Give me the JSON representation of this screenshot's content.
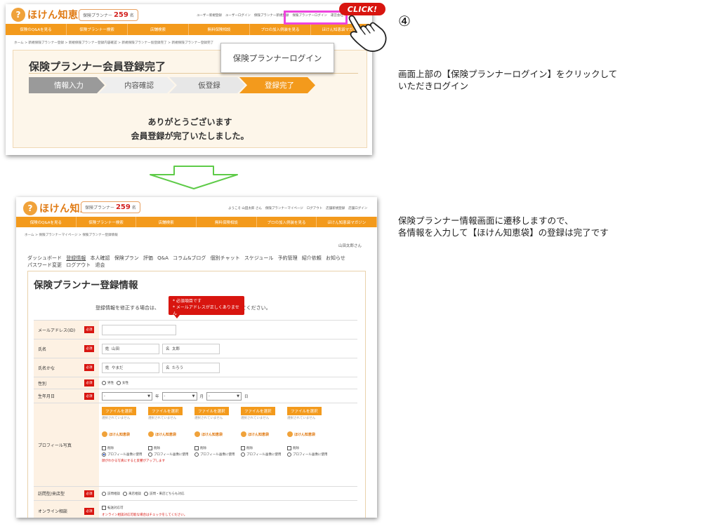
{
  "step_number": "④",
  "step1": {
    "description_lines": [
      "画面上部の【保険プランナーログイン】をクリックして",
      "いただきログイン"
    ],
    "site": {
      "logo_text": "ほけん知恵袋",
      "count_label": "保険プランナー",
      "count_value": "259",
      "count_unit": "名",
      "top_links": [
        "ユーザー新規登録",
        "ユーザーログイン",
        "保険プランナー新規登録",
        "保険プランナーログイン",
        "運営会社"
      ],
      "nav": [
        "保険のQ&Aを見る",
        "保険プランナー検索",
        "店舗検索",
        "無料保険相談",
        "プロの加入例装を見る",
        "ほけん知恵袋マガジン"
      ],
      "breadcrumb": "ホーム > 新規保険プランナー登録 > 新規保険プランナー登録内容確認 > 新規保険プランナー仮登録完了 > 新規保険プランナー登録完了"
    },
    "page_title": "保険プランナー会員登録完了",
    "steps": [
      "情報入力",
      "内容確認",
      "仮登録",
      "登録完了"
    ],
    "thanks_lines": [
      "ありがとうございます",
      "会員登録が完了いたしました。"
    ],
    "popup_label": "保険プランナーログイン",
    "click_label": "CLICK!"
  },
  "step2": {
    "description_lines": [
      "保険プランナー情報画面に遷移しますので、",
      "各情報を入力して【ほけん知恵袋】の登録は完了です"
    ],
    "site": {
      "logo_text": "ほけん知恵袋",
      "count_label": "保険プランナー",
      "count_value": "259",
      "count_unit": "名",
      "top_links": [
        "ようこそ 山田太郎 さん",
        "保険プランナーマイページ",
        "ログアウト",
        "店舗新規登録",
        "店舗ログイン"
      ],
      "nav": [
        "保険のQ&Aを見る",
        "保険プランナー検索",
        "店舗検索",
        "無料保険相談",
        "プロの加入例装を見る",
        "ほけん知恵袋マガジン"
      ],
      "breadcrumb": "ホーム > 保険プランナーマイページ > 保険プランナー登録情報"
    },
    "user_name": "山田太郎さん",
    "dashboard_menu": [
      "ダッシュボード",
      "登録情報",
      "本人確認",
      "保険プラン",
      "評価",
      "Q&A",
      "コラム&ブログ",
      "個別チャット",
      "スケジュール",
      "予約管理",
      "紹介依頼",
      "お知らせ",
      "パスワード変更",
      "ログアウト",
      "退会"
    ],
    "current_menu": "登録情報",
    "page_title": "保険プランナー登録情報",
    "subtitle_before": "登録情報を修正する場合は、",
    "subtitle_after": "を押してください。",
    "error_lines": [
      "* 必須項目です",
      "* メールアドレスが正しくありません"
    ],
    "required_label": "必須",
    "fields": {
      "email": "メールアドレス(ID)",
      "name": "氏名",
      "kana": "氏名かな",
      "gender": "性別",
      "birth": "生年月日",
      "photo": "プロフィール写真",
      "visit": "訪問型/来店型",
      "online": "オンライン相談"
    },
    "values": {
      "last_name_prefix": "姓",
      "last_name": "山田",
      "first_name_prefix": "名",
      "first_name": "太郎",
      "last_kana": "やまだ",
      "first_kana": "たろう",
      "gender_options": [
        "男性",
        "女性"
      ],
      "date_placeholder": "-",
      "year_unit": "年",
      "month_unit": "月",
      "day_unit": "日",
      "file_button": "ファイルを選択",
      "file_none": "選択されていません",
      "delete_label": "削除",
      "use_first": "プロフィール画像に使用",
      "use_other": "プロフィール画像に使用",
      "photo_note": "顔がわかる写真にすると反響がアップします",
      "visit_options": [
        "訪問相談",
        "来店相談",
        "訪問・来店どちらも対応"
      ],
      "online_option": "転送対応可",
      "online_note": "オンライン相談対応可能な場合はチェックをしてください。"
    }
  },
  "colors": {
    "brand_orange": "#f39a1c",
    "accent_red": "#d8150f",
    "highlight_pink": "#ee44dd",
    "arrow_green": "#5ecb48"
  }
}
